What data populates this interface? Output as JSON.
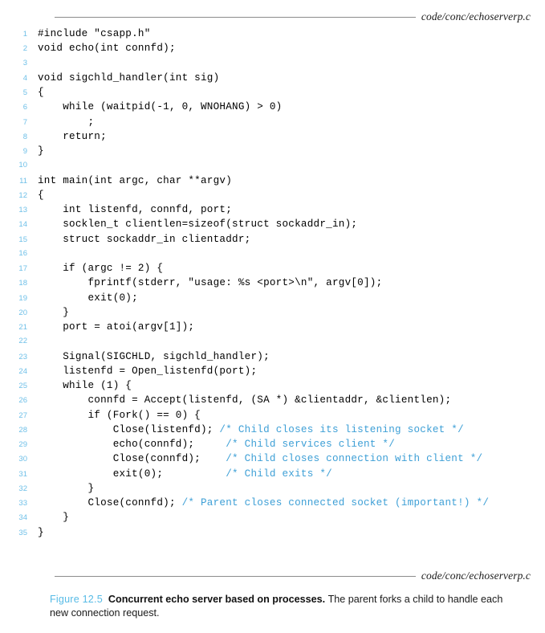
{
  "figure": {
    "source_file_top": "code/conc/echoserverp.c",
    "source_file_bottom": "code/conc/echoserverp.c",
    "caption_label": "Figure 12.5",
    "caption_title": "Concurrent echo server based on processes.",
    "caption_body": "The parent forks a child to handle each new connection request.",
    "colors": {
      "line_number": "#6fc0e8",
      "comment": "#3d9fd6",
      "caption_label": "#57bbe6",
      "rule": "#8c8c8c",
      "code": "#000000",
      "background": "#ffffff"
    }
  },
  "code": {
    "language": "c",
    "first_line_number": 1,
    "last_line_number": 35,
    "lines": [
      {
        "n": "1",
        "code": "#include \"csapp.h\"",
        "comment": ""
      },
      {
        "n": "2",
        "code": "void echo(int connfd);",
        "comment": ""
      },
      {
        "n": "3",
        "code": "",
        "comment": ""
      },
      {
        "n": "4",
        "code": "void sigchld_handler(int sig)",
        "comment": ""
      },
      {
        "n": "5",
        "code": "{",
        "comment": ""
      },
      {
        "n": "6",
        "code": "    while (waitpid(-1, 0, WNOHANG) > 0)",
        "comment": ""
      },
      {
        "n": "7",
        "code": "        ;",
        "comment": ""
      },
      {
        "n": "8",
        "code": "    return;",
        "comment": ""
      },
      {
        "n": "9",
        "code": "}",
        "comment": ""
      },
      {
        "n": "10",
        "code": "",
        "comment": ""
      },
      {
        "n": "11",
        "code": "int main(int argc, char **argv)",
        "comment": ""
      },
      {
        "n": "12",
        "code": "{",
        "comment": ""
      },
      {
        "n": "13",
        "code": "    int listenfd, connfd, port;",
        "comment": ""
      },
      {
        "n": "14",
        "code": "    socklen_t clientlen=sizeof(struct sockaddr_in);",
        "comment": ""
      },
      {
        "n": "15",
        "code": "    struct sockaddr_in clientaddr;",
        "comment": ""
      },
      {
        "n": "16",
        "code": "",
        "comment": ""
      },
      {
        "n": "17",
        "code": "    if (argc != 2) {",
        "comment": ""
      },
      {
        "n": "18",
        "code": "        fprintf(stderr, \"usage: %s <port>\\n\", argv[0]);",
        "comment": ""
      },
      {
        "n": "19",
        "code": "        exit(0);",
        "comment": ""
      },
      {
        "n": "20",
        "code": "    }",
        "comment": ""
      },
      {
        "n": "21",
        "code": "    port = atoi(argv[1]);",
        "comment": ""
      },
      {
        "n": "22",
        "code": "",
        "comment": ""
      },
      {
        "n": "23",
        "code": "    Signal(SIGCHLD, sigchld_handler);",
        "comment": ""
      },
      {
        "n": "24",
        "code": "    listenfd = Open_listenfd(port);",
        "comment": ""
      },
      {
        "n": "25",
        "code": "    while (1) {",
        "comment": ""
      },
      {
        "n": "26",
        "code": "        connfd = Accept(listenfd, (SA *) &clientaddr, &clientlen);",
        "comment": ""
      },
      {
        "n": "27",
        "code": "        if (Fork() == 0) {",
        "comment": ""
      },
      {
        "n": "28",
        "code": "            Close(listenfd); ",
        "comment": "/* Child closes its listening socket */"
      },
      {
        "n": "29",
        "code": "            echo(connfd);     ",
        "comment": "/* Child services client */"
      },
      {
        "n": "30",
        "code": "            Close(connfd);    ",
        "comment": "/* Child closes connection with client */"
      },
      {
        "n": "31",
        "code": "            exit(0);          ",
        "comment": "/* Child exits */"
      },
      {
        "n": "32",
        "code": "        }",
        "comment": ""
      },
      {
        "n": "33",
        "code": "        Close(connfd); ",
        "comment": "/* Parent closes connected socket (important!) */"
      },
      {
        "n": "34",
        "code": "    }",
        "comment": ""
      },
      {
        "n": "35",
        "code": "}",
        "comment": ""
      }
    ]
  }
}
